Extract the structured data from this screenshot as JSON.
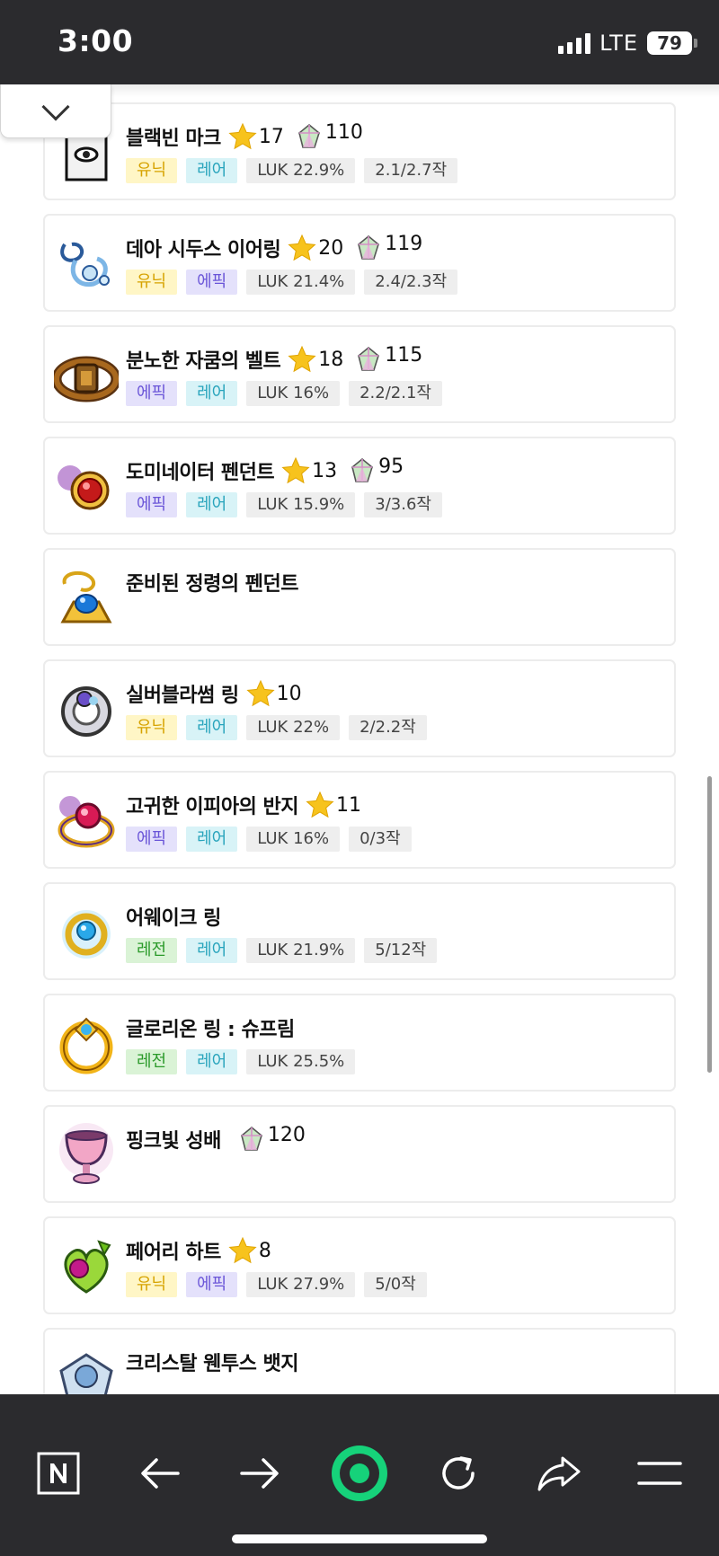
{
  "status_bar": {
    "time": "3:00",
    "network": "LTE",
    "battery": "79"
  },
  "items": [
    {
      "name": "블랙빈 마크",
      "icon": "black-bean-mark-icon",
      "stars": "17",
      "potential": "110",
      "tags": [
        {
          "label": "유닉",
          "kind": "unique"
        },
        {
          "label": "레어",
          "kind": "rare"
        },
        {
          "label": "LUK 22.9%",
          "kind": "stat"
        },
        {
          "label": "2.1/2.7작",
          "kind": "scroll"
        }
      ]
    },
    {
      "name": "데아 시두스 이어링",
      "icon": "dea-sidus-earring-icon",
      "stars": "20",
      "potential": "119",
      "tags": [
        {
          "label": "유닉",
          "kind": "unique"
        },
        {
          "label": "에픽",
          "kind": "epic"
        },
        {
          "label": "LUK 21.4%",
          "kind": "stat"
        },
        {
          "label": "2.4/2.3작",
          "kind": "scroll"
        }
      ]
    },
    {
      "name": "분노한 자쿰의 벨트",
      "icon": "zakum-belt-icon",
      "stars": "18",
      "potential": "115",
      "tags": [
        {
          "label": "에픽",
          "kind": "epic"
        },
        {
          "label": "레어",
          "kind": "rare"
        },
        {
          "label": "LUK 16%",
          "kind": "stat"
        },
        {
          "label": "2.2/2.1작",
          "kind": "scroll"
        }
      ]
    },
    {
      "name": "도미네이터 펜던트",
      "icon": "dominator-pendant-icon",
      "stars": "13",
      "potential": "95",
      "tags": [
        {
          "label": "에픽",
          "kind": "epic"
        },
        {
          "label": "레어",
          "kind": "rare"
        },
        {
          "label": "LUK 15.9%",
          "kind": "stat"
        },
        {
          "label": "3/3.6작",
          "kind": "scroll"
        }
      ]
    },
    {
      "name": "준비된 정령의 펜던트",
      "icon": "spirit-pendant-icon",
      "stars": null,
      "potential": null,
      "tags": []
    },
    {
      "name": "실버블라썸 링",
      "icon": "silver-blossom-ring-icon",
      "stars": "10",
      "potential": null,
      "tags": [
        {
          "label": "유닉",
          "kind": "unique"
        },
        {
          "label": "레어",
          "kind": "rare"
        },
        {
          "label": "LUK 22%",
          "kind": "stat"
        },
        {
          "label": "2/2.2작",
          "kind": "scroll"
        }
      ]
    },
    {
      "name": "고귀한 이피아의 반지",
      "icon": "ifia-ring-icon",
      "stars": "11",
      "potential": null,
      "tags": [
        {
          "label": "에픽",
          "kind": "epic"
        },
        {
          "label": "레어",
          "kind": "rare"
        },
        {
          "label": "LUK 16%",
          "kind": "stat"
        },
        {
          "label": "0/3작",
          "kind": "scroll"
        }
      ]
    },
    {
      "name": "어웨이크 링",
      "icon": "awake-ring-icon",
      "stars": null,
      "potential": null,
      "tags": [
        {
          "label": "레전",
          "kind": "legend"
        },
        {
          "label": "레어",
          "kind": "rare"
        },
        {
          "label": "LUK 21.9%",
          "kind": "stat"
        },
        {
          "label": "5/12작",
          "kind": "scroll"
        }
      ]
    },
    {
      "name": "글로리온 링 : 슈프림",
      "icon": "glorion-ring-icon",
      "stars": null,
      "potential": null,
      "tags": [
        {
          "label": "레전",
          "kind": "legend"
        },
        {
          "label": "레어",
          "kind": "rare"
        },
        {
          "label": "LUK 25.5%",
          "kind": "stat"
        }
      ]
    },
    {
      "name": "핑크빛 성배",
      "icon": "pink-holy-cup-icon",
      "stars": null,
      "potential": "120",
      "tags": []
    },
    {
      "name": "페어리 하트",
      "icon": "fairy-heart-icon",
      "stars": "8",
      "potential": null,
      "tags": [
        {
          "label": "유닉",
          "kind": "unique"
        },
        {
          "label": "에픽",
          "kind": "epic"
        },
        {
          "label": "LUK 27.9%",
          "kind": "stat"
        },
        {
          "label": "5/0작",
          "kind": "scroll"
        }
      ]
    },
    {
      "name": "크리스탈 웬투스 뱃지",
      "icon": "crystal-ventus-badge-icon",
      "stars": null,
      "potential": null,
      "tags": []
    }
  ],
  "toolbar": {
    "buttons": [
      {
        "name": "naver-home-button",
        "icon": "n-logo-icon"
      },
      {
        "name": "back-button",
        "icon": "arrow-left-icon"
      },
      {
        "name": "forward-button",
        "icon": "arrow-right-icon"
      },
      {
        "name": "green-dot-button",
        "icon": "green-dot-icon"
      },
      {
        "name": "reload-button",
        "icon": "reload-icon"
      },
      {
        "name": "share-button",
        "icon": "share-arrow-icon"
      },
      {
        "name": "menu-button",
        "icon": "hamburger-menu-icon"
      }
    ]
  },
  "colors": {
    "bar_background": "#2b2b2e",
    "accent_green": "#16d27a",
    "star": "#f7c31d"
  }
}
